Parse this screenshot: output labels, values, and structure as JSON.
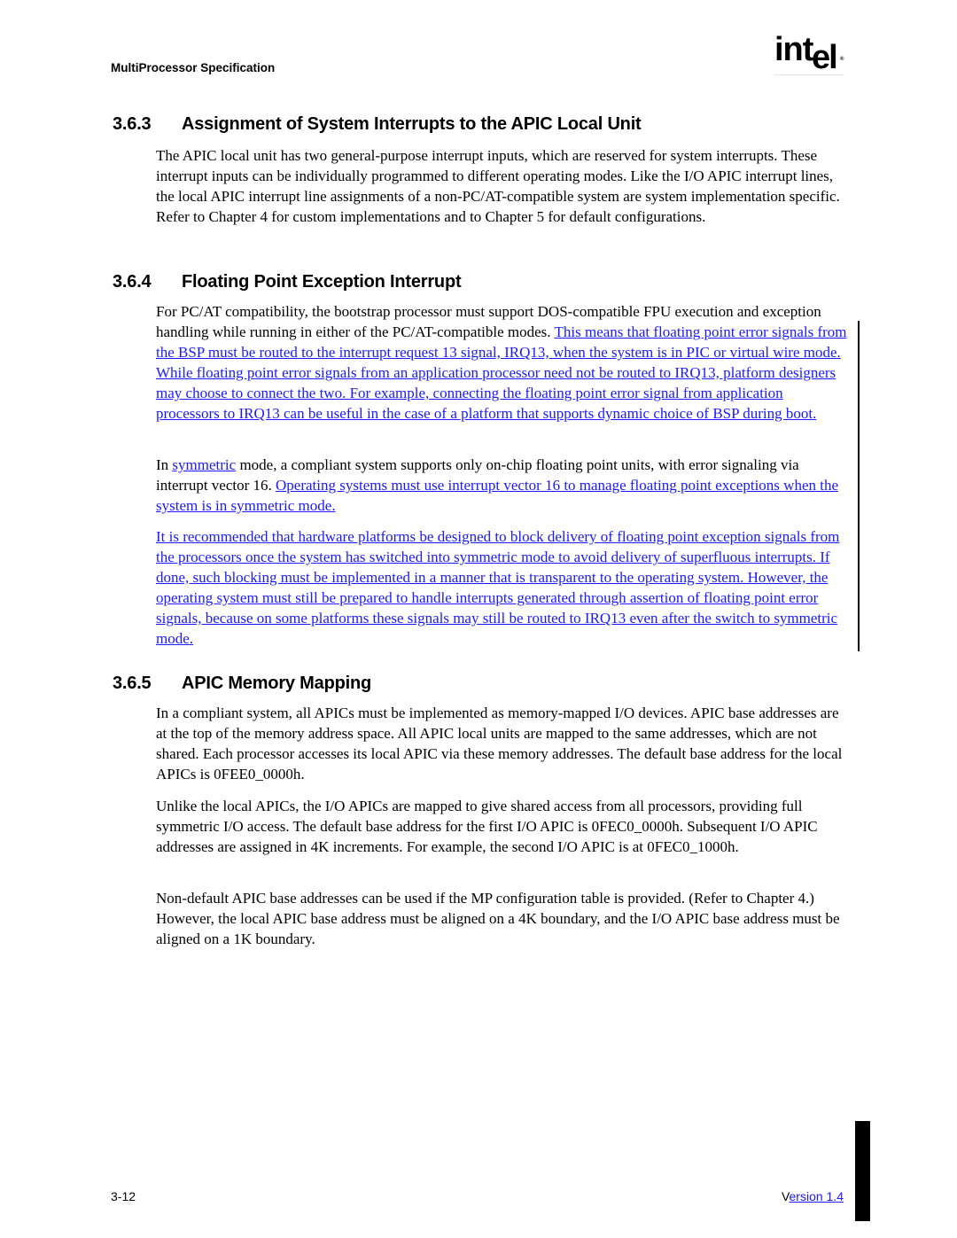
{
  "header": {
    "running_title": "MultiProcessor Specification",
    "logo": {
      "main": "int",
      "tail": "el",
      "mark": "®"
    }
  },
  "sections": [
    {
      "number": "3.6.3",
      "title": "Assignment of System Interrupts to the APIC Local Unit",
      "paragraphs": [
        {
          "text": "The APIC local unit has two general-purpose interrupt inputs, which are reserved for system interrupts.  These interrupt inputs can be individually programmed to different operating modes. Like the I/O APIC interrupt lines, the local APIC interrupt line assignments of a non-PC/AT-compatible system are system implementation specific.  Refer to Chapter 4 for custom implementations and to Chapter 5 for default configurations."
        }
      ]
    },
    {
      "number": "3.6.4",
      "title": "Floating Point Exception Interrupt",
      "paragraphs": [
        {
          "pre": "For PC/AT compatibility, the bootstrap processor must support DOS-compatible FPU execution and exception handling while running in either of the PC/AT-compatible modes.  ",
          "link": "This means that floating point error signals from the BSP must be routed to the interrupt request 13 signal, IRQ13, when the system is in PIC or virtual wire mode. While floating point error signals from an application processor need not be routed to IRQ13, platform designers may choose to connect the two. For example, connecting the floating point error signal from application processors to IRQ13 can be useful in the case of a platform that supports dynamic choice of BSP during boot."
        },
        {
          "pre": "In ",
          "link1": "symmetric",
          "mid": " mode, a compliant system supports only on-chip floating point units, with error signaling via interrupt vector 16.  ",
          "link2": "Operating systems must use interrupt vector 16 to manage floating point exceptions when the system is in symmetric mode."
        },
        {
          "link": "It is recommended that hardware platforms be designed to block delivery of floating point exception signals from the processors once the system has switched into symmetric mode to avoid delivery of superfluous interrupts.  If done, such blocking must be implemented in a manner that is transparent to the operating system.  However, the operating system must still be prepared to handle interrupts generated through assertion of floating point error signals, because on some platforms these signals may still be routed to IRQ13 even after the switch to symmetric mode."
        }
      ]
    },
    {
      "number": "3.6.5",
      "title": "APIC Memory Mapping",
      "paragraphs": [
        {
          "text": "In a compliant system, all APICs must be implemented as memory-mapped I/O devices.  APIC base addresses are at the top of the memory address space.  All APIC local units are mapped to the same addresses, which are not shared.  Each processor accesses its local APIC via these memory addresses.  The default base address for the local APICs is 0FEE0_0000h."
        },
        {
          "text": "Unlike the local APICs, the I/O APICs are mapped to give shared access from all processors, providing full symmetric I/O access.  The default base address for the first I/O APIC is 0FEC0_0000h.  Subsequent I/O APIC addresses are assigned in 4K increments.  For example, the second I/O APIC is at 0FEC0_1000h."
        },
        {
          "text": "Non-default APIC base addresses can be used if the MP configuration table is provided.  (Refer to Chapter 4.)  However, the local APIC base address must be aligned on a 4K boundary, and the I/O APIC base address must be aligned on a 1K boundary."
        }
      ]
    }
  ],
  "footer": {
    "page_number": "3-12",
    "version_first": "V",
    "version_rest": "ersion 1.4"
  },
  "colors": {
    "link": "#1a1aff",
    "text": "#000000",
    "background": "#ffffff"
  }
}
